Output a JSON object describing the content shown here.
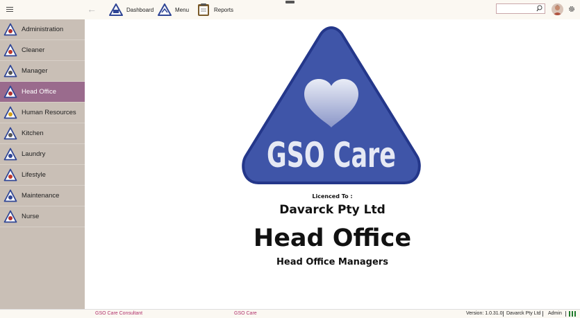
{
  "toolbar": {
    "dashboard_label": "Dashboard",
    "menu_label": "Menu",
    "reports_label": "Reports",
    "search_placeholder": "",
    "icons": [
      "hamburger-icon",
      "back-arrow-icon",
      "dashboard-icon",
      "menu-icon",
      "reports-icon",
      "search-icon",
      "avatar",
      "gear-icon"
    ]
  },
  "sidebar": {
    "active_index": 3,
    "items": [
      {
        "label": "Administration"
      },
      {
        "label": "Cleaner"
      },
      {
        "label": "Manager"
      },
      {
        "label": "Head Office"
      },
      {
        "label": "Human Resources"
      },
      {
        "label": "Kitchen"
      },
      {
        "label": "Laundry"
      },
      {
        "label": "Lifestyle"
      },
      {
        "label": "Maintenance"
      },
      {
        "label": "Nurse"
      }
    ]
  },
  "main": {
    "logo_text": "GSO Care",
    "licenced_to": "Licenced To :",
    "company": "Davarck Pty Ltd",
    "office": "Head Office",
    "group": "Head Office Managers"
  },
  "status": {
    "left": "GSO Care Consultant",
    "center": "GSO Care",
    "version": "Version: 1.0.31.0",
    "company": "Davarck Pty Ltd",
    "user": "Admin"
  },
  "colors": {
    "accent": "#9a6b8d",
    "sidebar_bg": "#c9bfb6",
    "logo_blue": "#3f55a8",
    "status_pink": "#b0306a",
    "status_green": "#1d7a2a"
  }
}
